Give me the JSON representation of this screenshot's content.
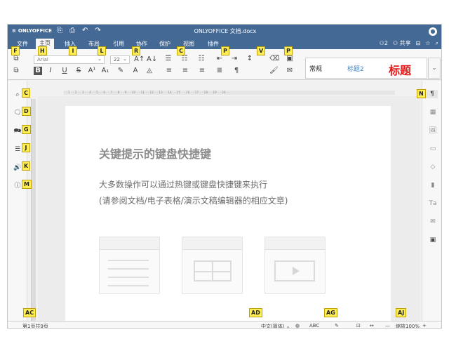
{
  "app": {
    "brand": "ONLYOFFICE",
    "document_title": "ONLYOFFICE 文档.docx",
    "avatar": "user-icon"
  },
  "title_tools": [
    {
      "name": "open-file-location-icon",
      "glyph": "⎘"
    },
    {
      "name": "print-icon",
      "glyph": "⎙"
    },
    {
      "name": "undo-icon",
      "glyph": "↶"
    },
    {
      "name": "redo-icon",
      "glyph": "↷"
    }
  ],
  "tabs": [
    {
      "label": "文件",
      "key": "F"
    },
    {
      "label": "主页",
      "key": "H"
    },
    {
      "label": "插入",
      "key": "I"
    },
    {
      "label": "布局",
      "key": "L"
    },
    {
      "label": "引用",
      "key": "R"
    },
    {
      "label": "协作",
      "key": "C"
    },
    {
      "label": "保护",
      "key": "P"
    },
    {
      "label": "视图",
      "key": "V"
    },
    {
      "label": "插件",
      "key": "P"
    }
  ],
  "header_right": {
    "users": "2",
    "share": "共享"
  },
  "toolbar": {
    "font_name": "Arial",
    "font_size": "22",
    "styles": [
      {
        "label": "常规",
        "color": "#222222"
      },
      {
        "label": "标题2",
        "color": "#3d86c7"
      },
      {
        "label": "标题",
        "color": "#e21919"
      }
    ]
  },
  "hints": {
    "f": "F",
    "h": "H",
    "i": "I",
    "l": "L",
    "r": "R",
    "c": "C",
    "p1": "P",
    "v": "V",
    "p2": "P",
    "c2": "C",
    "d": "D",
    "g": "G",
    "j": "J",
    "k": "K",
    "m": "M",
    "n": "N",
    "ac": "AC",
    "ad": "AD",
    "ag": "AG",
    "aj": "AJ"
  },
  "left_sidebar": [
    {
      "name": "search-icon",
      "glyph": "⌕"
    },
    {
      "name": "comments-icon",
      "glyph": "🗨"
    },
    {
      "name": "chat-icon",
      "glyph": "🗪"
    },
    {
      "name": "navigation-icon",
      "glyph": "☰"
    },
    {
      "name": "read-aloud-icon",
      "glyph": "🔊"
    },
    {
      "name": "about-icon",
      "glyph": "ⓘ"
    }
  ],
  "right_sidebar": [
    {
      "name": "paragraph-settings-icon",
      "glyph": "¶"
    },
    {
      "name": "table-settings-icon",
      "glyph": "▦"
    },
    {
      "name": "image-settings-icon",
      "glyph": "🖼"
    },
    {
      "name": "header-footer-icon",
      "glyph": "▭"
    },
    {
      "name": "shape-settings-icon",
      "glyph": "◇"
    },
    {
      "name": "chart-settings-icon",
      "glyph": "▮"
    },
    {
      "name": "text-art-icon",
      "glyph": "Tа"
    },
    {
      "name": "mail-merge-icon",
      "glyph": "✉"
    },
    {
      "name": "form-settings-icon",
      "glyph": "▣"
    }
  ],
  "page": {
    "heading": "关键提示的键盘快捷键",
    "line1": "大多数操作可以通过热键或键盘快捷键来执行",
    "line2": "(请参阅文档/电子表格/演示文稿编辑器的相应文章)"
  },
  "statusbar": {
    "page_count": "第1页共9页",
    "language": "中文(简体) ⌄",
    "zoom": "缩放100%",
    "zoom_out": "—",
    "zoom_in": "+"
  }
}
